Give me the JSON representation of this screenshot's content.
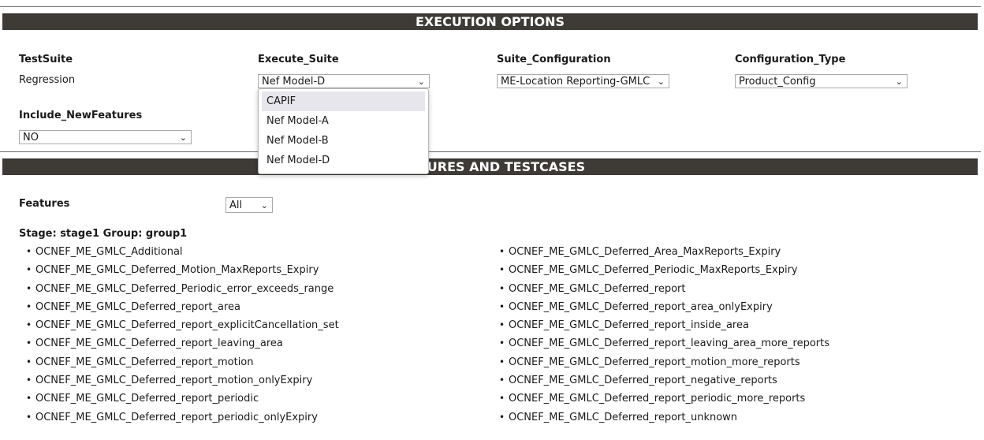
{
  "execution_options": {
    "header": "EXECUTION OPTIONS",
    "testsuite": {
      "label": "TestSuite",
      "value": "Regression"
    },
    "execute_suite": {
      "label": "Execute_Suite",
      "selected": "Nef Model-D",
      "options": [
        "CAPIF",
        "Nef Model-A",
        "Nef Model-B",
        "Nef Model-D"
      ]
    },
    "suite_configuration": {
      "label": "Suite_Configuration",
      "selected": "ME-Location Reporting-GMLC"
    },
    "configuration_type": {
      "label": "Configuration_Type",
      "selected": "Product_Config"
    },
    "include_newfeatures": {
      "label": "Include_NewFeatures",
      "selected": "NO"
    }
  },
  "features_section": {
    "header": "SELECT FEATURES AND TESTCASES",
    "visible_header_fragment": "TURES AND TESTCASES",
    "features_label": "Features",
    "features_selected": "All",
    "group_title": "Stage: stage1 Group: group1",
    "left_testcases": [
      "OCNEF_ME_GMLC_Additional",
      "OCNEF_ME_GMLC_Deferred_Motion_MaxReports_Expiry",
      "OCNEF_ME_GMLC_Deferred_Periodic_error_exceeds_range",
      "OCNEF_ME_GMLC_Deferred_report_area",
      "OCNEF_ME_GMLC_Deferred_report_explicitCancellation_set",
      "OCNEF_ME_GMLC_Deferred_report_leaving_area",
      "OCNEF_ME_GMLC_Deferred_report_motion",
      "OCNEF_ME_GMLC_Deferred_report_motion_onlyExpiry",
      "OCNEF_ME_GMLC_Deferred_report_periodic",
      "OCNEF_ME_GMLC_Deferred_report_periodic_onlyExpiry"
    ],
    "right_testcases": [
      "OCNEF_ME_GMLC_Deferred_Area_MaxReports_Expiry",
      "OCNEF_ME_GMLC_Deferred_Periodic_MaxReports_Expiry",
      "OCNEF_ME_GMLC_Deferred_report",
      "OCNEF_ME_GMLC_Deferred_report_area_onlyExpiry",
      "OCNEF_ME_GMLC_Deferred_report_inside_area",
      "OCNEF_ME_GMLC_Deferred_report_leaving_area_more_reports",
      "OCNEF_ME_GMLC_Deferred_report_motion_more_reports",
      "OCNEF_ME_GMLC_Deferred_report_negative_reports",
      "OCNEF_ME_GMLC_Deferred_report_periodic_more_reports",
      "OCNEF_ME_GMLC_Deferred_report_unknown"
    ]
  }
}
